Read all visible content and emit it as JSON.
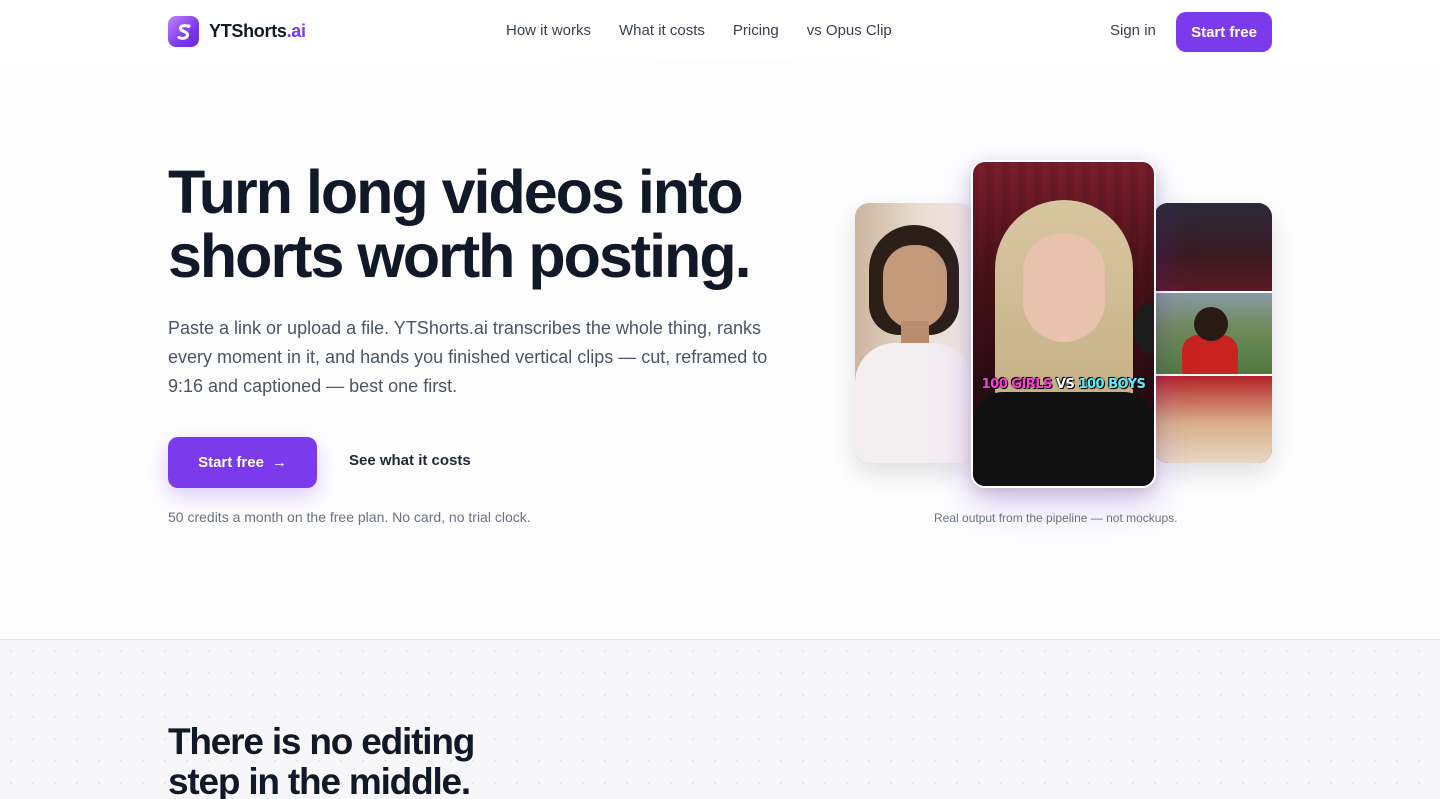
{
  "brand": {
    "name": "YTShorts",
    "tld": ".ai",
    "logo_icon": "s-logo-icon",
    "accent": "#7c3aed"
  },
  "nav": {
    "items": [
      "How it works",
      "What it costs",
      "Pricing",
      "vs Opus Clip"
    ]
  },
  "header": {
    "signin_label": "Sign in",
    "cta_label": "Start free"
  },
  "hero": {
    "headline_line1": "Turn long videos into",
    "headline_line2": "shorts worth posting.",
    "lede": "Paste a link or upload a file. YTShorts.ai transcribes the whole thing, ranks every moment in it, and hands you finished vertical clips — cut, reframed to 9:16 and captioned — best one first.",
    "primary_cta": "Start free",
    "arrow_icon": "arrow-right-icon",
    "secondary_cta": "See what it costs",
    "fineprint": "50 credits a month on the free plan. No card, no trial clock."
  },
  "showcase": {
    "caption_part1": "100 GIRLS",
    "caption_part2": "VS",
    "caption_part3": "100 BOYS",
    "note": "Real output from the pipeline — not mockups."
  },
  "section2": {
    "title_line1": "There is no editing",
    "title_line2": "step in the middle."
  }
}
